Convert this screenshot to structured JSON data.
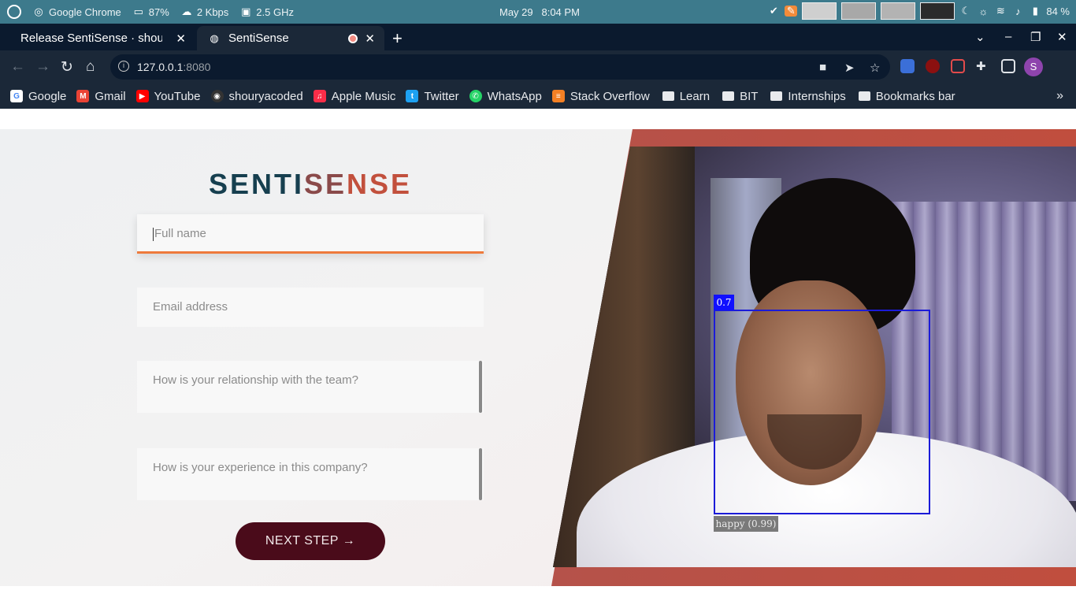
{
  "os_bar": {
    "app_name": "Google Chrome",
    "cpu": "87%",
    "network": "2 Kbps",
    "freq": "2.5 GHz",
    "date": "May 29",
    "time": "8:04 PM",
    "battery": "84 %",
    "icons": [
      "activities-icon",
      "chrome-icon",
      "cpu-icon",
      "cloud-icon",
      "chip-icon",
      "check-icon",
      "pen-icon",
      "moon-icon",
      "brightness-icon",
      "wifi-icon",
      "volume-icon",
      "battery-icon"
    ]
  },
  "tabs": [
    {
      "label": "Release SentiSense · shouryacoded",
      "active": false
    },
    {
      "label": "SentiSense",
      "active": true
    }
  ],
  "toolbar": {
    "url_host": "127.0.0.1",
    "url_port": ":8080",
    "profile_initial": "S"
  },
  "bookmarks": [
    {
      "label": "Google",
      "color": "#4285f4",
      "glyph": "G"
    },
    {
      "label": "Gmail",
      "color": "#ea4335",
      "glyph": "M"
    },
    {
      "label": "YouTube",
      "color": "#ff0000",
      "glyph": "▶"
    },
    {
      "label": "shouryacoded",
      "color": "#333333",
      "glyph": "◉"
    },
    {
      "label": "Apple Music",
      "color": "#fa2d48",
      "glyph": "♫"
    },
    {
      "label": "Twitter",
      "color": "#1da1f2",
      "glyph": "t"
    },
    {
      "label": "WhatsApp",
      "color": "#25d366",
      "glyph": "✆"
    },
    {
      "label": "Stack Overflow",
      "color": "#f48024",
      "glyph": "≡"
    }
  ],
  "bookmark_folders": [
    "Learn",
    "BIT",
    "Internships",
    "Bookmarks bar"
  ],
  "form": {
    "logo_part1": "SENTI",
    "logo_part2": "SE",
    "logo_part3": "NSE",
    "fullname_placeholder": "Full name",
    "email_placeholder": "Email address",
    "relationship_placeholder": "How is your relationship with the team?",
    "experience_placeholder": "How is your experience in this company?",
    "next_button": "NEXT STEP →"
  },
  "detection": {
    "score": "0.7",
    "label": "happy (0.99)"
  },
  "colors": {
    "os_bar": "#3d7a8c",
    "chrome_dark": "#0b1a2e",
    "accent_underline": "#ee7a3c",
    "button": "#4a0b1a",
    "box": "#1b1bd8"
  }
}
